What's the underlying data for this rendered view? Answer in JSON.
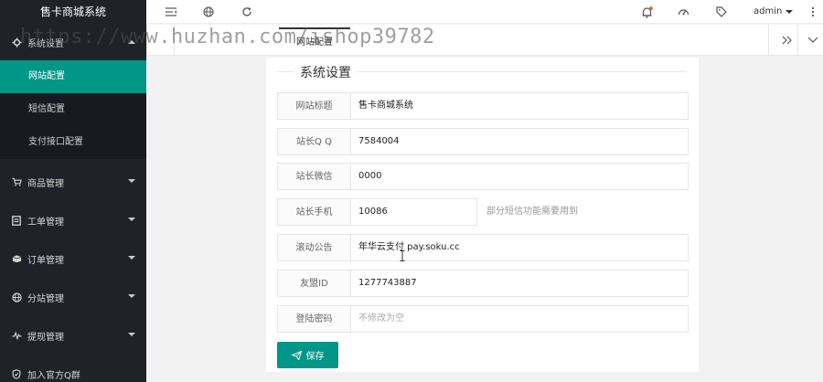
{
  "brand": "售卡商城系统",
  "sidebar": {
    "groups": [
      {
        "label": "系统设置",
        "icon": "gear-icon"
      },
      {
        "label": "商品管理",
        "icon": "cart-icon"
      },
      {
        "label": "工单管理",
        "icon": "ticket-icon"
      },
      {
        "label": "订单管理",
        "icon": "box-icon"
      },
      {
        "label": "分站管理",
        "icon": "globe-icon"
      },
      {
        "label": "提现管理",
        "icon": "chart-icon"
      },
      {
        "label": "加入官方Q群",
        "icon": "shield-icon"
      }
    ],
    "sub_items": [
      "网站配置",
      "短信配置",
      "支付接口配置"
    ]
  },
  "topbar": {
    "user": "admin"
  },
  "tabs": {
    "active_label": "网站配置"
  },
  "watermark": "https://www.huzhan.com/ishop39782",
  "form": {
    "legend": "系统设置",
    "fields": [
      {
        "label": "网站标题",
        "value": "售卡商城系统"
      },
      {
        "label": "站长Q Q",
        "value": "7584004"
      },
      {
        "label": "站长微信",
        "value": "0000"
      },
      {
        "label": "站长手机",
        "value": "10086",
        "aux": "部分短信功能需要用到"
      },
      {
        "label": "滚动公告",
        "value": "年华云支付 pay.soku.cc"
      },
      {
        "label": "友盟ID",
        "value": "1277743887"
      },
      {
        "label": "登陆密码",
        "placeholder": "不修改为空"
      }
    ],
    "save_label": "保存"
  },
  "colors": {
    "accent": "#009688",
    "sidebar_bg": "#20222a",
    "badge": "#ff5722"
  }
}
